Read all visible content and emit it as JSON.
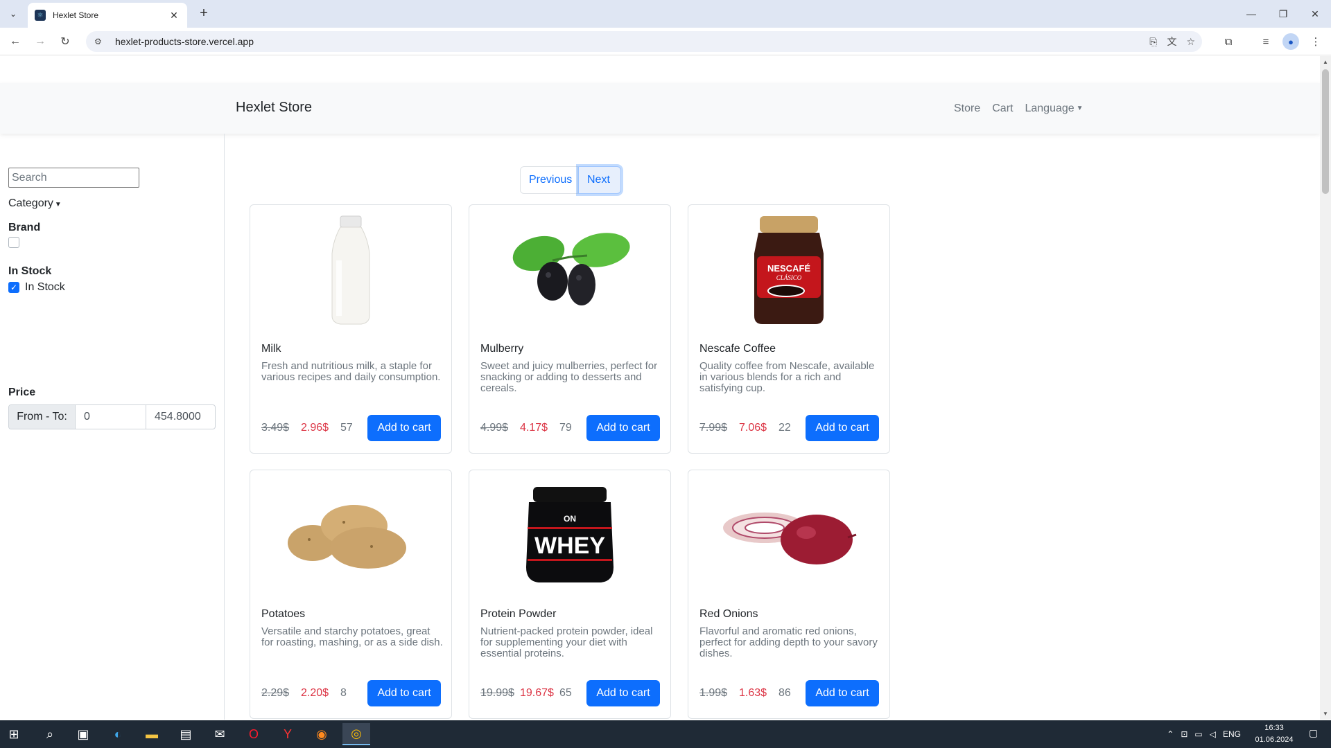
{
  "browser": {
    "tab_title": "Hexlet Store",
    "url": "hexlet-products-store.vercel.app"
  },
  "navbar": {
    "brand": "Hexlet Store",
    "links": [
      "Store",
      "Cart",
      "Language"
    ]
  },
  "sidebar": {
    "search_placeholder": "Search",
    "category_label": "Category",
    "brand_heading": "Brand",
    "in_stock_heading": "In Stock",
    "in_stock_label": "In Stock",
    "in_stock_checked": true,
    "price_heading": "Price",
    "price_range_label": "From - To:",
    "price_from": "0",
    "price_to": "454.8000"
  },
  "pagination": {
    "previous": "Previous",
    "next": "Next"
  },
  "products": [
    {
      "name": "Milk",
      "description": "Fresh and nutritious milk, a staple for various recipes and daily consumption.",
      "old_price": "3.49$",
      "new_price": "2.96$",
      "stock": "57",
      "button": "Add to cart",
      "icon": "milk-bottle-icon"
    },
    {
      "name": "Mulberry",
      "description": "Sweet and juicy mulberries, perfect for snacking or adding to desserts and cereals.",
      "old_price": "4.99$",
      "new_price": "4.17$",
      "stock": "79",
      "button": "Add to cart",
      "icon": "mulberry-icon"
    },
    {
      "name": "Nescafe Coffee",
      "description": "Quality coffee from Nescafe, available in various blends for a rich and satisfying cup.",
      "old_price": "7.99$",
      "new_price": "7.06$",
      "stock": "22",
      "button": "Add to cart",
      "icon": "coffee-jar-icon"
    },
    {
      "name": "Potatoes",
      "description": "Versatile and starchy potatoes, great for roasting, mashing, or as a side dish.",
      "old_price": "2.29$",
      "new_price": "2.20$",
      "stock": "8",
      "button": "Add to cart",
      "icon": "potatoes-icon"
    },
    {
      "name": "Protein Powder",
      "description": "Nutrient-packed protein powder, ideal for supplementing your diet with essential proteins.",
      "old_price": "19.99$",
      "new_price": "19.67$",
      "stock": "65",
      "button": "Add to cart",
      "icon": "protein-tub-icon"
    },
    {
      "name": "Red Onions",
      "description": "Flavorful and aromatic red onions, perfect for adding depth to your savory dishes.",
      "old_price": "1.99$",
      "new_price": "1.63$",
      "stock": "86",
      "button": "Add to cart",
      "icon": "red-onion-icon"
    }
  ],
  "product_images": {
    "nescafe_label": "NESCAFÉ",
    "nescafe_sublabel": "CLÁSICO",
    "whey_brand": "ON",
    "whey_label": "WHEY"
  },
  "taskbar": {
    "language": "ENG",
    "time": "16:33",
    "date": "01.06.2024"
  },
  "colors": {
    "primary": "#0d6efd",
    "sale_price": "#dc3545",
    "muted": "#6c757d",
    "navbar_bg": "#f8f9fa"
  }
}
